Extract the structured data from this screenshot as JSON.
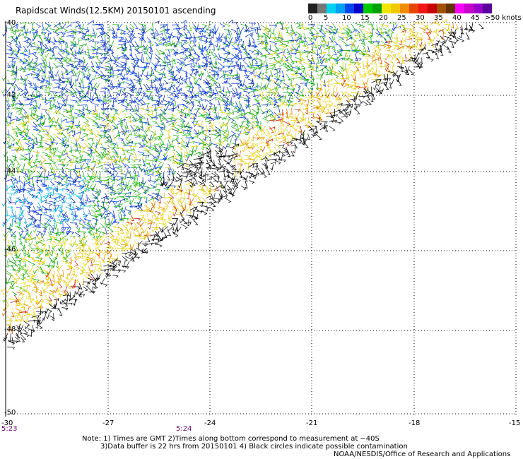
{
  "title": "Rapidscat Winds(12.5KM) 20150101 ascending",
  "colorbar": {
    "colors": [
      "#222222",
      "#777777",
      "#00d2f0",
      "#00a0f0",
      "#0044ee",
      "#0000c8",
      "#00c800",
      "#00a000",
      "#f0e600",
      "#f0c800",
      "#f08c00",
      "#e64600",
      "#f01414",
      "#c80000",
      "#a05000",
      "#643200",
      "#ff00ff",
      "#c800c8",
      "#9600c8",
      "#5a00a0"
    ],
    "labels": [
      "0",
      "5",
      "10",
      "15",
      "20",
      "25",
      "30",
      "35",
      "40",
      "45",
      ">50 knots"
    ]
  },
  "latitude_labels": [
    "-40",
    "-42",
    "-44",
    "-46",
    "-48",
    "-50"
  ],
  "longitude_labels": [
    "-30",
    "-27",
    "-24",
    "-21",
    "-18",
    "-15"
  ],
  "time_labels": [
    "5:23",
    "5:24"
  ],
  "notes": {
    "line1": "Note: 1) Times are GMT 2)Times along bottom correspond to measurement at ~40S",
    "line2": "3)Data buffer is 22 hrs from 20150101 4) Black circles indicate possible contamination",
    "credit": "NOAA/NESDIS/Office of Research and Applications"
  }
}
